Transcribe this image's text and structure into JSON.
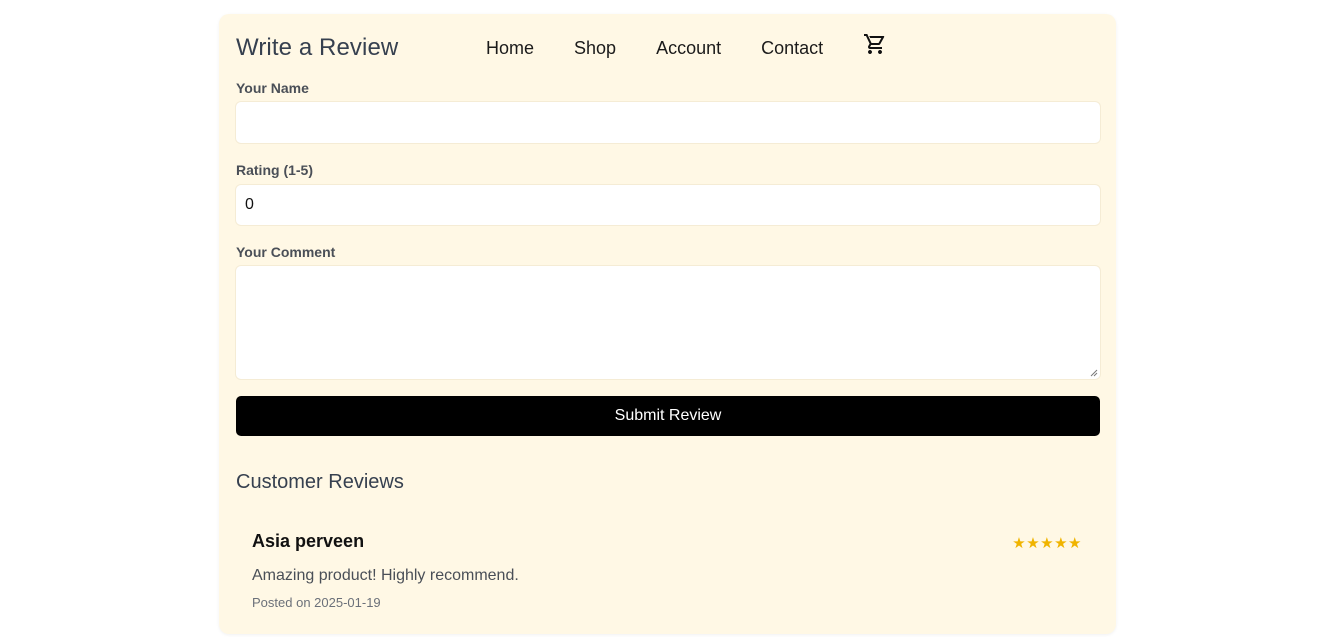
{
  "header": {
    "title": "Write a Review",
    "nav": [
      {
        "label": "Home"
      },
      {
        "label": "Shop"
      },
      {
        "label": "Account"
      },
      {
        "label": "Contact"
      }
    ],
    "cart_icon": "shopping-cart-icon"
  },
  "form": {
    "name_label": "Your Name",
    "name_value": "",
    "rating_label": "Rating (1-5)",
    "rating_value": "0",
    "comment_label": "Your Comment",
    "comment_value": "",
    "submit_label": "Submit Review"
  },
  "reviews": {
    "heading": "Customer Reviews",
    "items": [
      {
        "name": "Asia perveen",
        "stars": "★★★★★",
        "rating": 5,
        "comment": "Amazing product! Highly recommend.",
        "date": "Posted on 2025-01-19"
      }
    ]
  },
  "colors": {
    "card_background": "#fff8e5",
    "button_background": "#000000",
    "star_color": "#f0b400",
    "title_color": "#36404f"
  }
}
